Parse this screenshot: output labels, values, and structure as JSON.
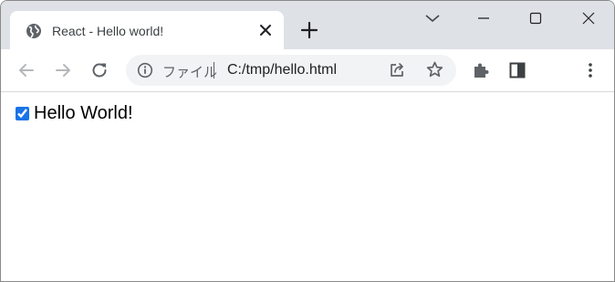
{
  "tab": {
    "title": "React - Hello world!"
  },
  "omnibox": {
    "scheme_label": "ファイル",
    "url": "C:/tmp/hello.html"
  },
  "page": {
    "todo": {
      "label": "Hello World!",
      "checked": true
    }
  },
  "colors": {
    "tabstrip": "#dee1e6",
    "omnibox": "#f1f3f4",
    "checkbox_accent": "#1a73e8"
  },
  "icons": {
    "favicon": "globe-icon",
    "tab_close": "close-icon",
    "new_tab": "plus-icon",
    "tab_search": "chevron-down-icon",
    "back": "arrow-left-icon",
    "forward": "arrow-right-icon",
    "reload": "reload-icon",
    "site_info": "info-icon",
    "share": "share-icon",
    "bookmark": "star-icon",
    "extensions": "puzzle-icon",
    "side_panel": "side-panel-icon",
    "menu": "kebab-menu-icon"
  }
}
